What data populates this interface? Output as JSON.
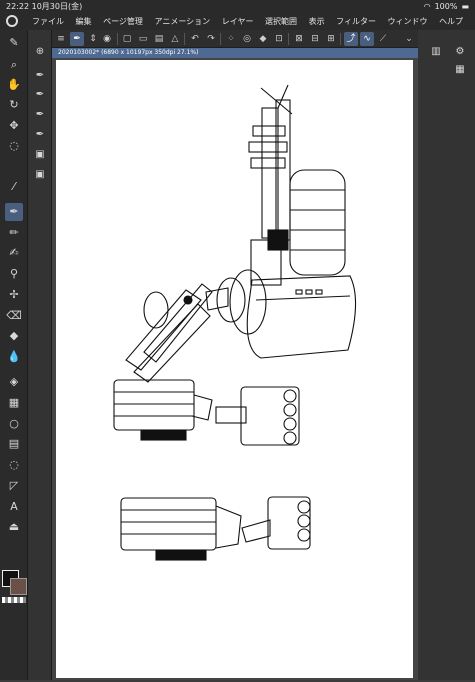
{
  "status_bar": {
    "time": "22:22",
    "date": "10月30日(金)",
    "wifi": "wifi-icon",
    "battery": "100%"
  },
  "menu": {
    "logo": "clip-studio-logo-icon",
    "items": [
      "ファイル",
      "編集",
      "ページ管理",
      "アニメーション",
      "レイヤー",
      "選択範囲",
      "表示",
      "フィルター",
      "ウィンドウ",
      "ヘルプ"
    ]
  },
  "document": {
    "tab_label": "2020103002* (6890 x 10197px 350dpi 27.1%)"
  },
  "tools": {
    "left": [
      "zoom-icon",
      "hand-icon",
      "rotate-icon",
      "move-icon",
      "lasso-icon",
      "eyedropper-icon",
      "pen-icon",
      "pencil-icon",
      "brush-icon",
      "airbrush-icon",
      "decoration-icon",
      "eraser-icon",
      "blend-icon",
      "fill-icon",
      "gradient-icon",
      "figure-icon",
      "frame-icon",
      "lasso-select-icon",
      "ruler-icon",
      "text-icon",
      "correction-icon"
    ],
    "active_left": "pen-icon",
    "sub": [
      "sub-zoom-icon",
      "sub-tool-1-icon",
      "sub-tool-2-icon",
      "sub-tool-3-icon",
      "sub-tool-4-icon",
      "sub-tool-5-icon",
      "sub-tool-6-icon"
    ],
    "right": [
      "layer-panel-icon",
      "property-panel-icon",
      "navigator-icon"
    ]
  },
  "colors": {
    "main": "#111111",
    "sub": "#6a5046",
    "accent": "#4a5f80"
  }
}
